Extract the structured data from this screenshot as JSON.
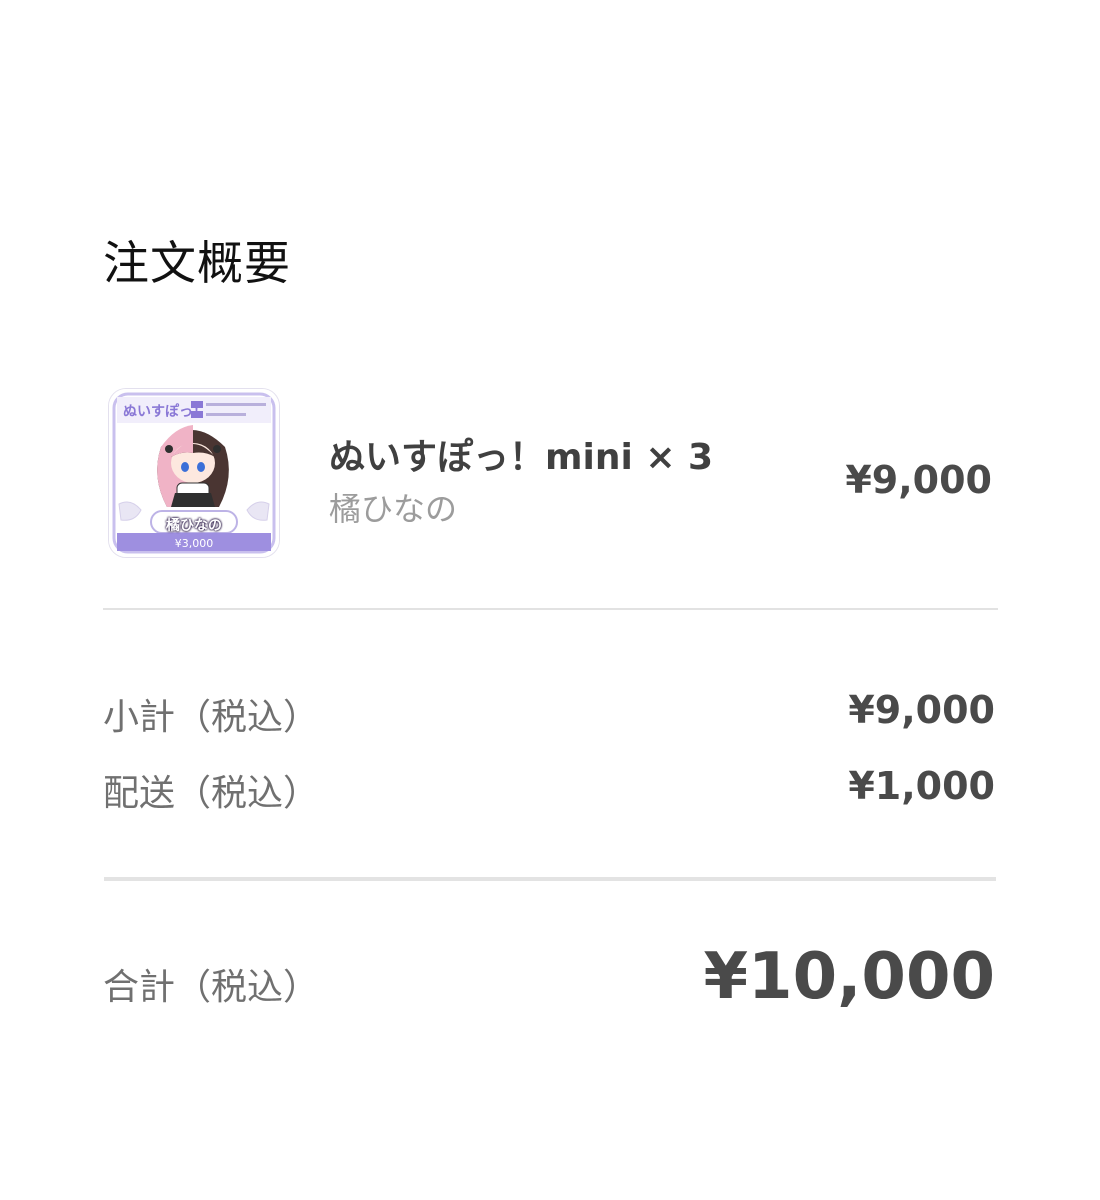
{
  "title": "注文概要",
  "item": {
    "name": "ぬいすぽっ！mini × 3",
    "shop": "橘ひなの",
    "price": "¥9,000",
    "thumbnail": {
      "logo": "ぬいすぽっ！",
      "character_name": "橘ひなの",
      "unit_price": "¥3,000"
    }
  },
  "summary": {
    "subtotal_label": "小計（税込）",
    "subtotal_value": "¥9,000",
    "shipping_label": "配送（税込）",
    "shipping_value": "¥1,000"
  },
  "total": {
    "label": "合計（税込）",
    "value": "¥10,000"
  },
  "colors": {
    "thumb_accent": "#8a78d6",
    "text_dark": "#4a4a4a",
    "text_muted": "#9c9c9c",
    "divider": "#e2e2e2"
  }
}
